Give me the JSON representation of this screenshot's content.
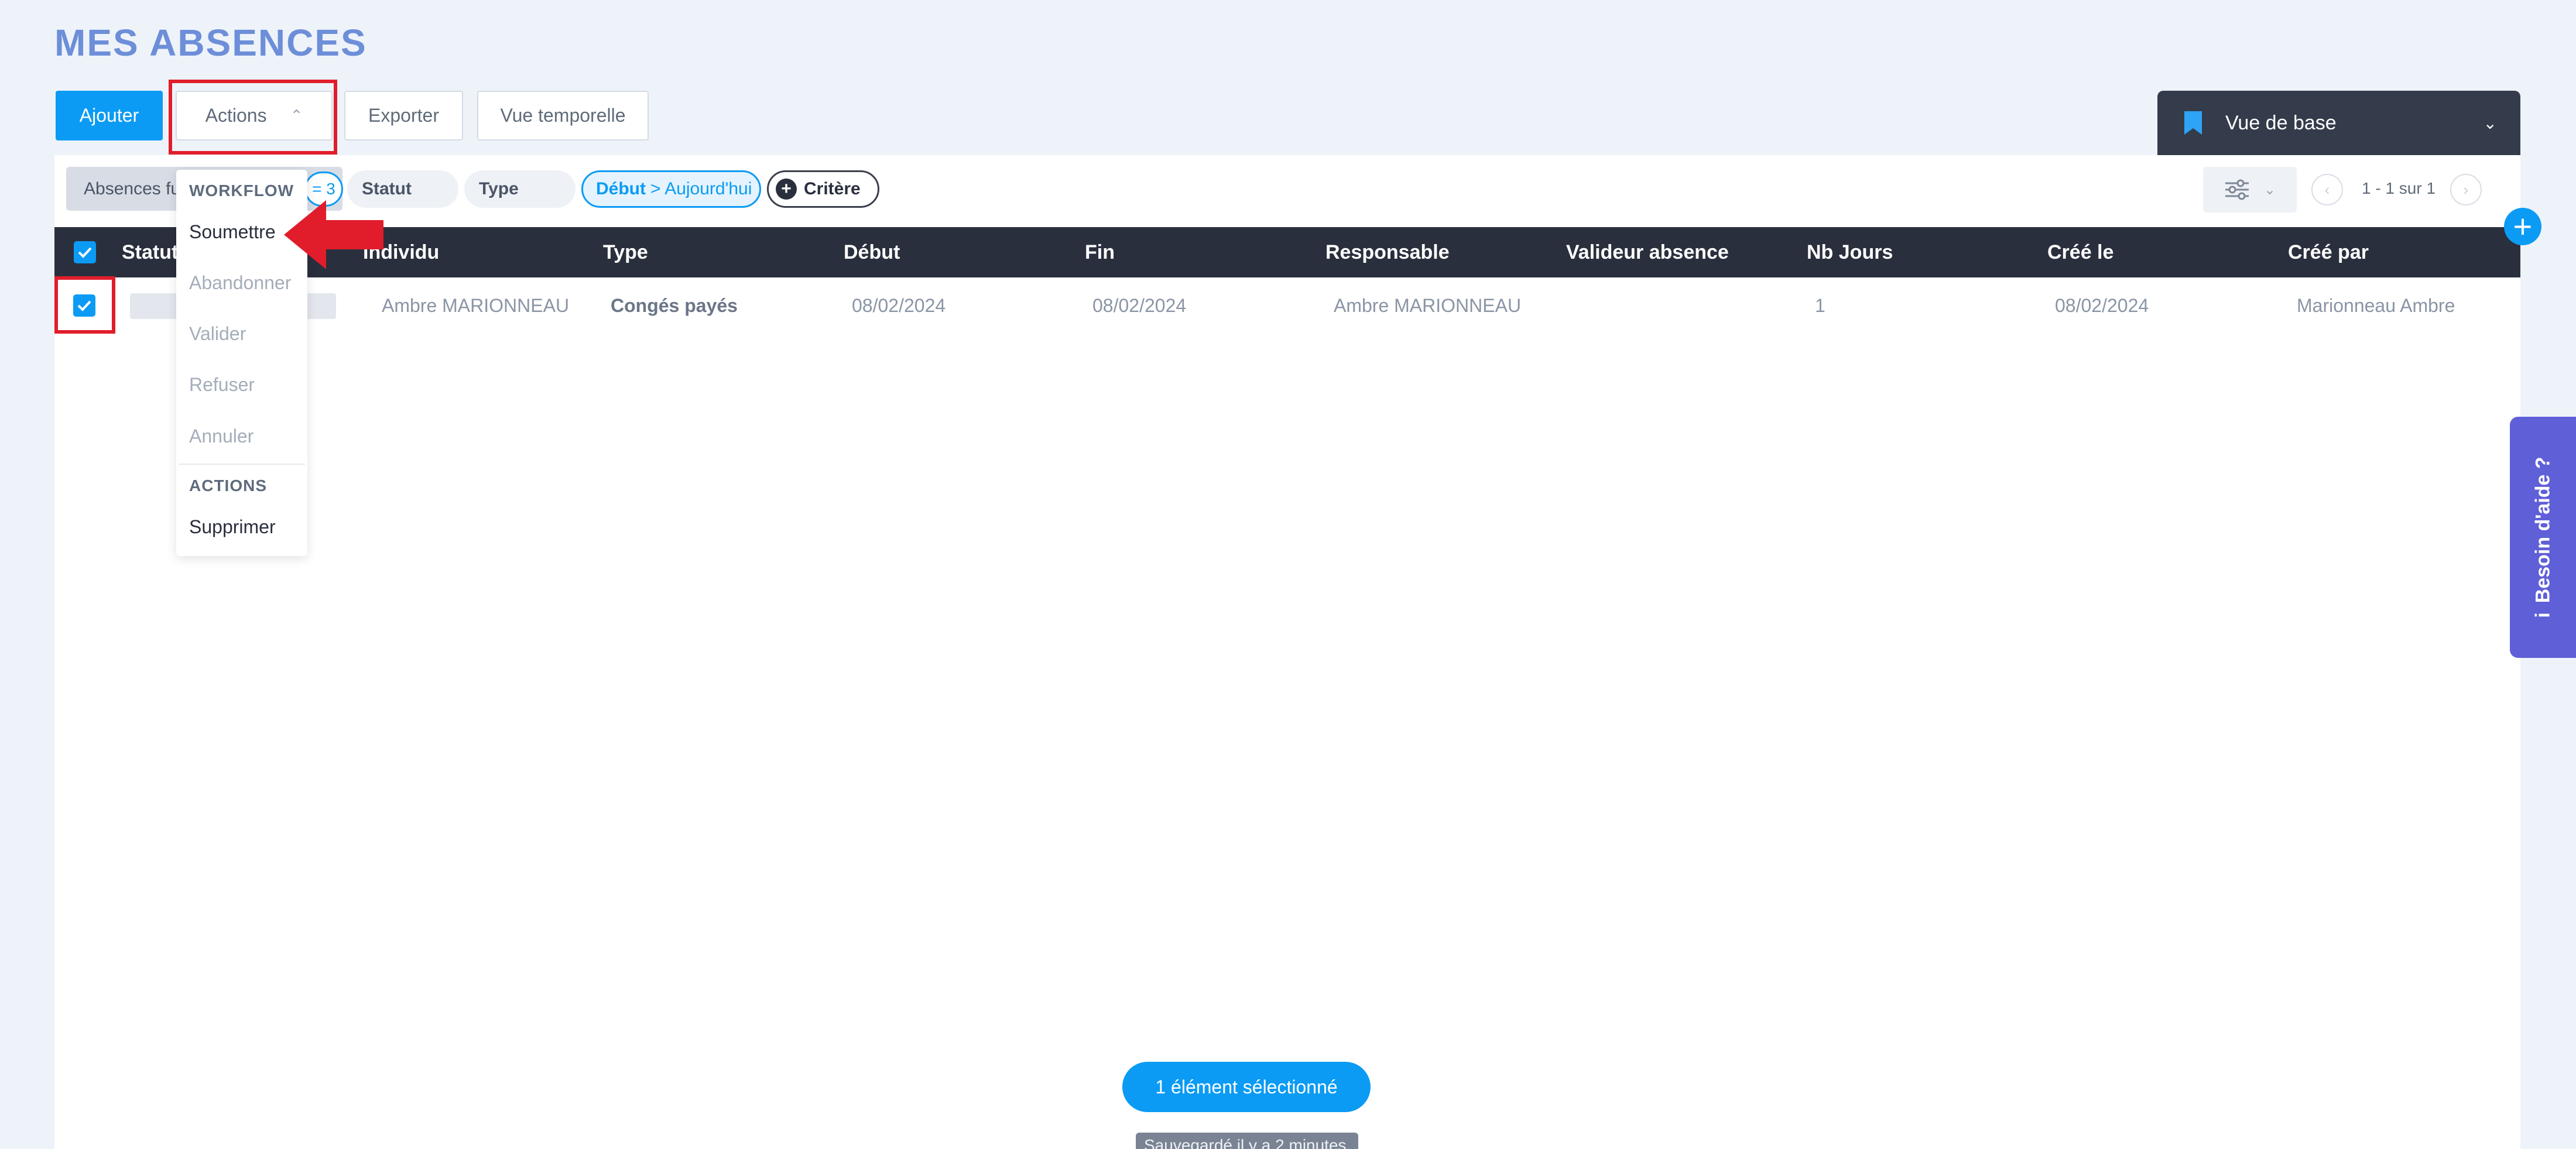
{
  "page": {
    "title": "MES ABSENCES"
  },
  "toolbar": {
    "add_label": "Ajouter",
    "actions_label": "Actions",
    "export_label": "Exporter",
    "timeline_label": "Vue temporelle"
  },
  "view_selector": {
    "label": "Vue de base"
  },
  "filters": {
    "saved_filter_label": "Absences fu",
    "saved_filter_count": "= 3",
    "status_label": "Statut",
    "type_label": "Type",
    "date_filter_key": "Début",
    "date_filter_value": "> Aujourd'hui",
    "add_criterion_label": "Critère"
  },
  "pagination": {
    "label": "1 - 1 sur 1"
  },
  "table": {
    "columns": [
      "Statut",
      "Individu",
      "Type",
      "Début",
      "Fin",
      "Responsable",
      "Valideur absence",
      "Nb Jours",
      "Créé le",
      "Créé par"
    ],
    "rows": [
      {
        "statut": "",
        "individu": "Ambre MARIONNEAU",
        "type": "Congés payés",
        "debut": "08/02/2024",
        "fin": "08/02/2024",
        "responsable": "Ambre MARIONNEAU",
        "valideur": "",
        "nb_jours": "1",
        "cree_le": "08/02/2024",
        "cree_par": "Marionneau Ambre"
      }
    ]
  },
  "actions_menu": {
    "workflow_header": "WORKFLOW",
    "items": [
      "Soumettre",
      "Abandonner",
      "Valider",
      "Refuser",
      "Annuler"
    ],
    "actions_header": "ACTIONS",
    "delete_label": "Supprimer"
  },
  "selection": {
    "label": "1 élément sélectionné"
  },
  "saved_toast": {
    "label": "Sauvegardé il y a 2 minutes"
  },
  "help": {
    "label": "Besoin d'aide ?"
  },
  "colors": {
    "accent": "#0b9bf4",
    "title": "#6d8ed8",
    "header_bg": "#2a2f3d",
    "annotation": "#e11d2b",
    "help_bg": "#5f5fd8"
  }
}
